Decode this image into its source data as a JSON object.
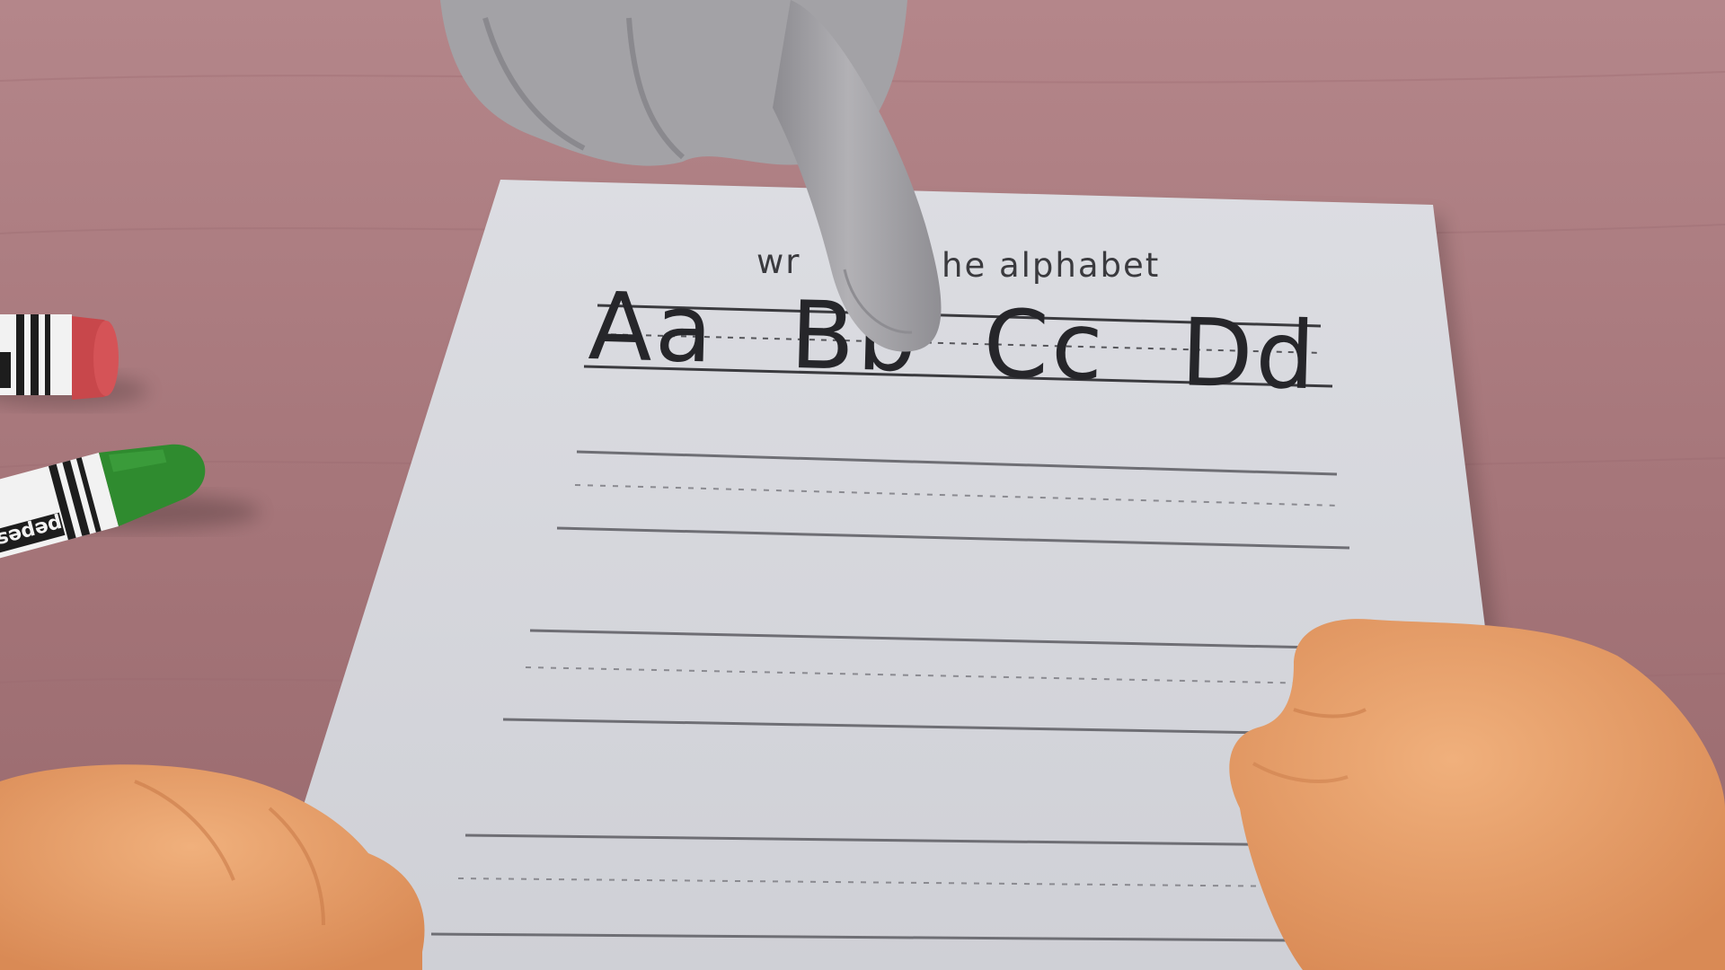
{
  "worksheet": {
    "caption_left": "wr",
    "caption_right": "he alphabet",
    "letters": [
      "Aa",
      "Bb",
      "Cc",
      "Dd"
    ]
  },
  "crayons": [
    {
      "name": "red-crayon",
      "label": "",
      "color": "#c8474b"
    },
    {
      "name": "green-crayon",
      "label": "pepesc",
      "color": "#2f8b2f"
    }
  ],
  "colors": {
    "table": "#a8777a",
    "paper": "#d9dadf",
    "finger": "#a3a2a6",
    "skin": "#e8a26d"
  }
}
